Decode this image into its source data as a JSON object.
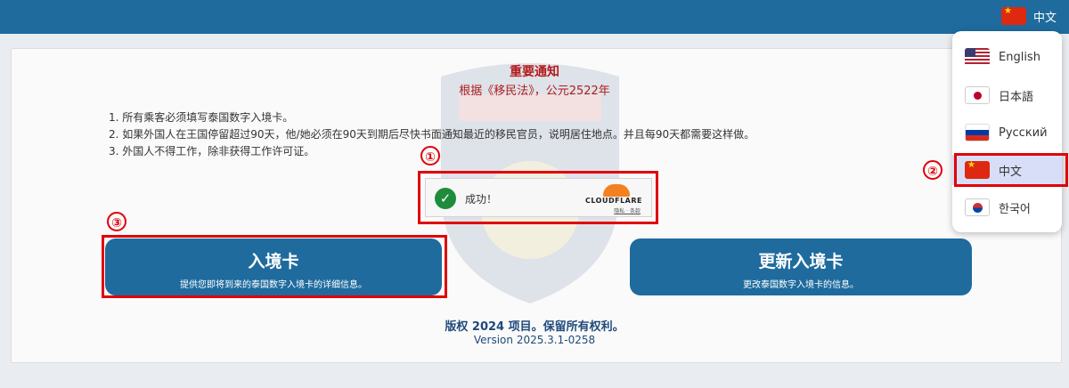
{
  "header": {
    "current_language": "中文",
    "current_flag_icon": "china-flag-icon"
  },
  "notice": {
    "title": "重要通知",
    "subtitle": "根据《移民法》，公元2522年",
    "rules": [
      "1. 所有乘客必须填写泰国数字入境卡。",
      "2. 如果外国人在王国停留超过90天，他/她必须在90天到期后尽快书面通知最近的移民官员，说明居住地点。并且每90天都需要这样做。",
      "3. 外国人不得工作，除非获得工作许可证。"
    ]
  },
  "captcha": {
    "status_text": "成功！",
    "provider": "CLOUDFLARE",
    "links": "隐私 · 条款"
  },
  "buttons": {
    "arrival_card": {
      "title": "入境卡",
      "subtitle": "提供您即将到来的泰国数字入境卡的详细信息。"
    },
    "update_card": {
      "title": "更新入境卡",
      "subtitle": "更改泰国数字入境卡的信息。"
    }
  },
  "footer": {
    "copyright": "版权 2024 项目。保留所有权利。",
    "version": "Version 2025.3.1-0258"
  },
  "language_menu": {
    "items": [
      {
        "label": "English",
        "icon": "us-flag-icon"
      },
      {
        "label": "日本語",
        "icon": "japan-flag-icon"
      },
      {
        "label": "Русский",
        "icon": "russia-flag-icon"
      },
      {
        "label": "中文",
        "icon": "china-flag-icon",
        "selected": true
      },
      {
        "label": "한국어",
        "icon": "korea-flag-icon"
      }
    ]
  },
  "annotations": {
    "marker_1": "①",
    "marker_2": "②",
    "marker_3": "③"
  },
  "colors": {
    "primary": "#1f6b9e",
    "notice_red": "#b31b1b",
    "highlight": "#e0000a",
    "success": "#1e8c3c"
  }
}
